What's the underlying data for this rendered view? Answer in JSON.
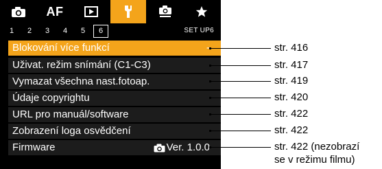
{
  "tabs": [
    {
      "name": "shooting-tab",
      "icon": "camera-icon",
      "label": ""
    },
    {
      "name": "af-tab",
      "icon": "",
      "label": "AF"
    },
    {
      "name": "playback-tab",
      "icon": "playback-icon",
      "label": ""
    },
    {
      "name": "setup-tab",
      "icon": "wrench-icon",
      "label": "",
      "active": true
    },
    {
      "name": "custom-functions-tab",
      "icon": "custom-camera-icon",
      "label": ""
    },
    {
      "name": "my-menu-tab",
      "icon": "star-icon",
      "label": ""
    }
  ],
  "subtabs": {
    "items": [
      "1",
      "2",
      "3",
      "4",
      "5",
      "6"
    ],
    "active": "6",
    "info": "SET UP6"
  },
  "menu": {
    "items": [
      {
        "label": "Blokování více funkcí",
        "value": "-",
        "selected": true
      },
      {
        "label": "Uživat. režim snímání (C1-C3)",
        "value": ""
      },
      {
        "label": "Vymazat všechna nast.fotoap.",
        "value": ""
      },
      {
        "label": "Údaje copyrightu",
        "value": ""
      },
      {
        "label": "URL pro manuál/software",
        "value": ""
      },
      {
        "label": "Zobrazení loga osvědčení",
        "value": ""
      },
      {
        "label": "Firmware",
        "value": "Ver. 1.0.0",
        "value_icon": "camera-icon"
      }
    ]
  },
  "callouts": [
    {
      "text": "str. 416"
    },
    {
      "text": "str. 417"
    },
    {
      "text": "str. 419"
    },
    {
      "text": "str. 420"
    },
    {
      "text": "str. 422"
    },
    {
      "text": "str. 422"
    },
    {
      "text": "str. 422 (nezobrazí",
      "text2": "se v režimu filmu)"
    }
  ],
  "colors": {
    "accent": "#f4a41b",
    "screen_bg": "#000000",
    "row_bg": "#1c1c1c",
    "text": "#ffffff",
    "callout": "#000000"
  }
}
